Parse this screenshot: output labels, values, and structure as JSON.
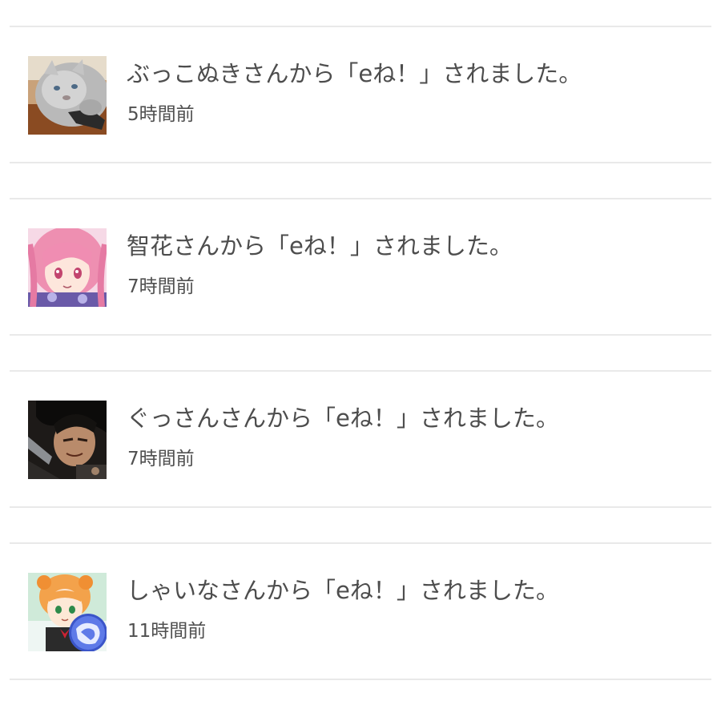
{
  "notifications": [
    {
      "message": "ぶっこぬきさんから「eね！」されました。",
      "time": "5時間前",
      "avatar_icon": "gray-cat-avatar-icon"
    },
    {
      "message": "智花さんから「eね！」されました。",
      "time": "7時間前",
      "avatar_icon": "pink-hair-anime-girl-avatar-icon"
    },
    {
      "message": "ぐっさんさんから「eね！」されました。",
      "time": "7時間前",
      "avatar_icon": "dark-hair-anime-warrior-avatar-icon"
    },
    {
      "message": "しゃいなさんから「eね！」されました。",
      "time": "11時間前",
      "avatar_icon": "orange-hair-anime-girl-avatar-icon"
    }
  ]
}
